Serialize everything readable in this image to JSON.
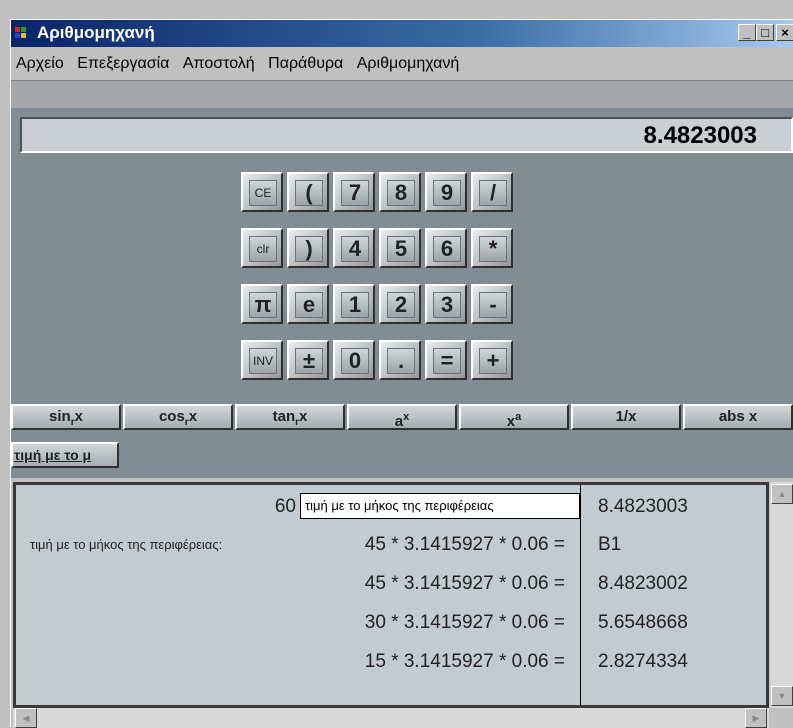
{
  "window": {
    "title": "Αριθμομηχανή"
  },
  "menu": [
    "Αρχείο",
    "Επεξεργασία",
    "Αποστολή",
    "Παράθυρα",
    "Αριθμομηχανή"
  ],
  "display": {
    "value": "8.4823003"
  },
  "keypad": [
    [
      "CE",
      "(",
      "7",
      "8",
      "9",
      "/"
    ],
    [
      "clr",
      ")",
      "4",
      "5",
      "6",
      "*"
    ],
    [
      "π",
      "e",
      "1",
      "2",
      "3",
      "-"
    ],
    [
      "INV",
      "±",
      "0",
      ".",
      "=",
      "+"
    ]
  ],
  "functions": {
    "sin": {
      "base": "sin",
      "sub": "r",
      "var": "x"
    },
    "cos": {
      "base": "cos",
      "sub": "r",
      "var": "x"
    },
    "tan": {
      "base": "tan",
      "sub": "r",
      "var": "x"
    },
    "ax": {
      "base": "a",
      "sup": "x"
    },
    "xa": {
      "base": "x",
      "sup": "a"
    },
    "inv": "1/x",
    "abs": "abs x",
    "user": "τιμή με το μ"
  },
  "sheet": {
    "input_number": "60",
    "input_text": "τιμή με το μήκος της περιφέρειας",
    "label": "τιμή με το μήκος της περιφέρειας:",
    "rows": [
      {
        "expr": "45 * 3.1415927 * 0.06 =",
        "result": "B1"
      },
      {
        "expr": "45 * 3.1415927 * 0.06 =",
        "result": "8.4823002"
      },
      {
        "expr": "30 * 3.1415927 * 0.06 =",
        "result": "5.6548668"
      },
      {
        "expr": "15 * 3.1415927 * 0.06 =",
        "result": "2.8274334"
      }
    ],
    "top_result": "8.4823003"
  }
}
